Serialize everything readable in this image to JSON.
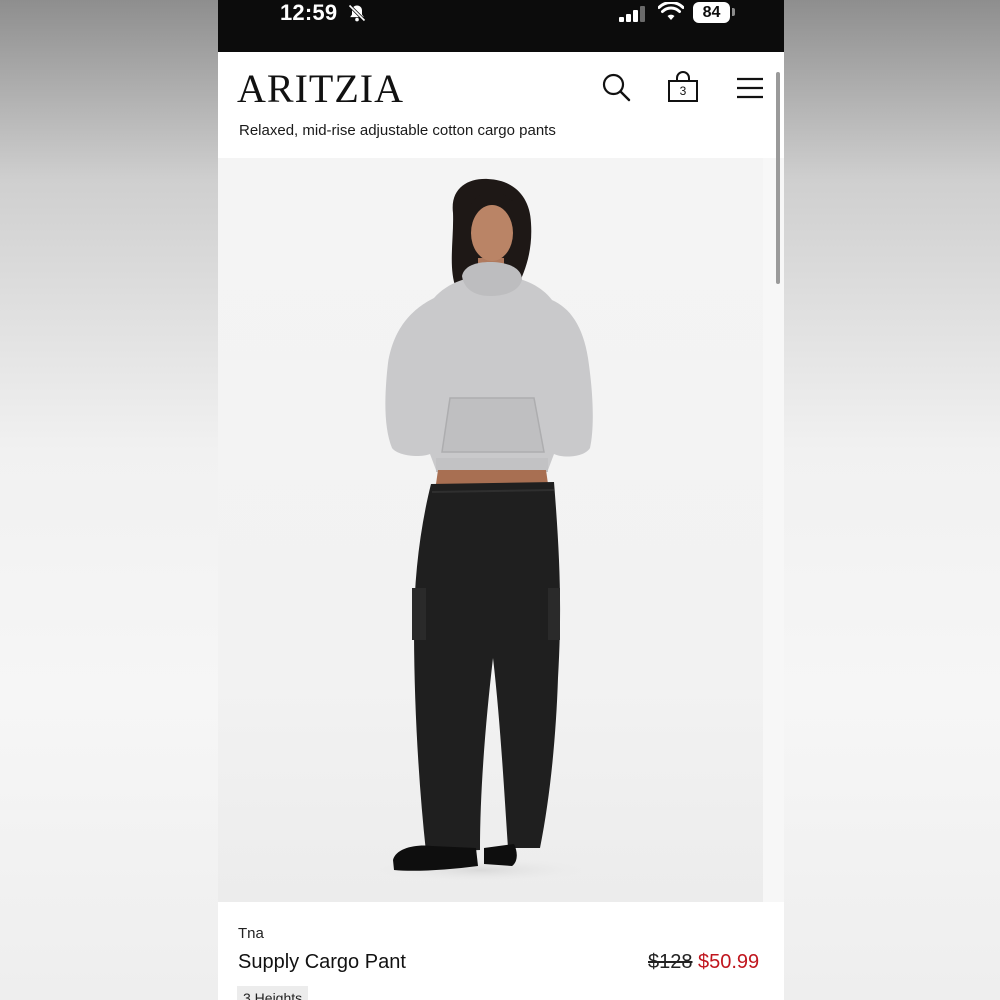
{
  "status_bar": {
    "time": "12:59",
    "battery_level": "84"
  },
  "header": {
    "brand": "ARITZIA",
    "bag_count": "3",
    "subtitle": "Relaxed, mid-rise adjustable cotton cargo pants"
  },
  "product": {
    "brand": "Tna",
    "name": "Supply Cargo Pant",
    "price_original": "$128",
    "price_sale": "$50.99",
    "badge": "3 Heights"
  },
  "colors": {
    "sale_price": "#c0161e",
    "status_bar_bg": "#0c0c0c",
    "page_bg": "#ffffff"
  },
  "icons": {
    "status": [
      "bell-slash-icon",
      "signal-icon",
      "wifi-icon",
      "battery-icon"
    ],
    "header": [
      "search-icon",
      "shopping-bag-icon",
      "menu-icon"
    ]
  }
}
